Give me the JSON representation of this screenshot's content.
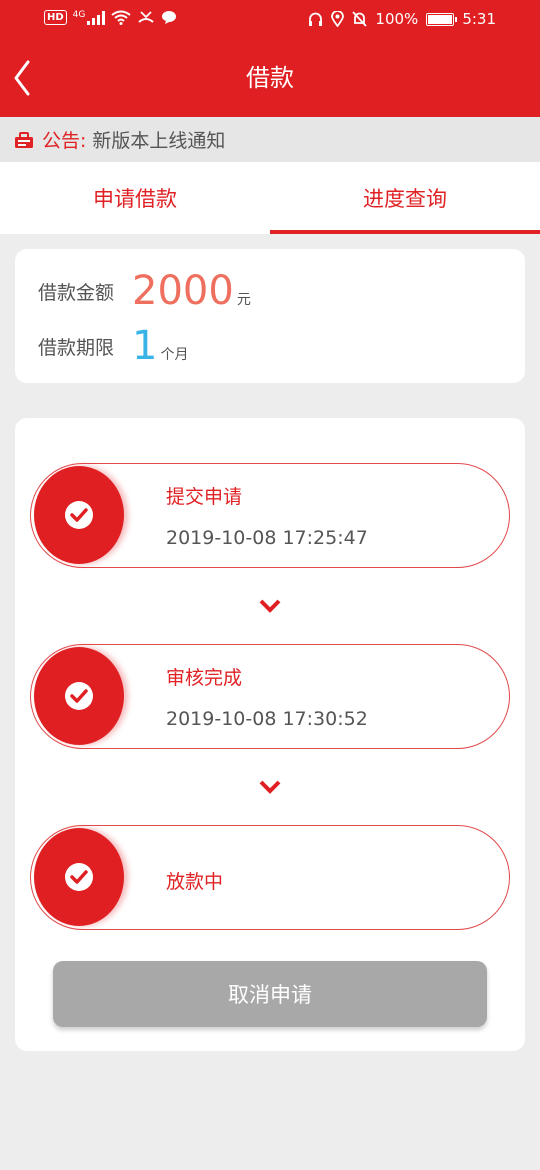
{
  "status_bar": {
    "hd": "HD",
    "net": "4G",
    "battery": "100%",
    "time": "5:31"
  },
  "header": {
    "title": "借款"
  },
  "notice": {
    "prefix": "公告:",
    "text": "新版本上线通知"
  },
  "tabs": [
    {
      "label": "申请借款",
      "active": false
    },
    {
      "label": "进度查询",
      "active": true
    }
  ],
  "loan": {
    "amount_label": "借款金额",
    "amount": "2000",
    "amount_unit": "元",
    "term_label": "借款期限",
    "term": "1",
    "term_unit": "个月"
  },
  "steps": [
    {
      "title": "提交申请",
      "time": "2019-10-08 17:25:47"
    },
    {
      "title": "审核完成",
      "time": "2019-10-08 17:30:52"
    },
    {
      "title": "放款中",
      "time": ""
    }
  ],
  "cancel_label": "取消申请",
  "colors": {
    "primary": "#e01f22",
    "amount": "#ef6f5e",
    "term": "#3ab4e6",
    "button_disabled": "#a8a8a8"
  }
}
